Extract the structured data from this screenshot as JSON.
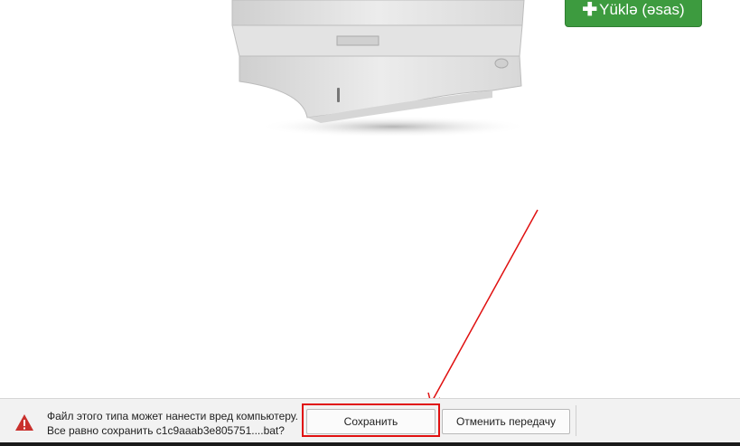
{
  "page": {
    "download_button_label": "Yüklə (əsas)",
    "download_button_icon": "plus-icon",
    "accent_color": "#3d9b3f"
  },
  "download_bar": {
    "warning_icon": "warning-triangle-icon",
    "warning_line1": "Файл этого типа может нанести вред компьютеру.",
    "warning_line2": "Все равно сохранить c1c9aaab3e805751....bat?",
    "save_label": "Сохранить",
    "cancel_label": "Отменить передачу",
    "annotation_color": "#e01010"
  }
}
